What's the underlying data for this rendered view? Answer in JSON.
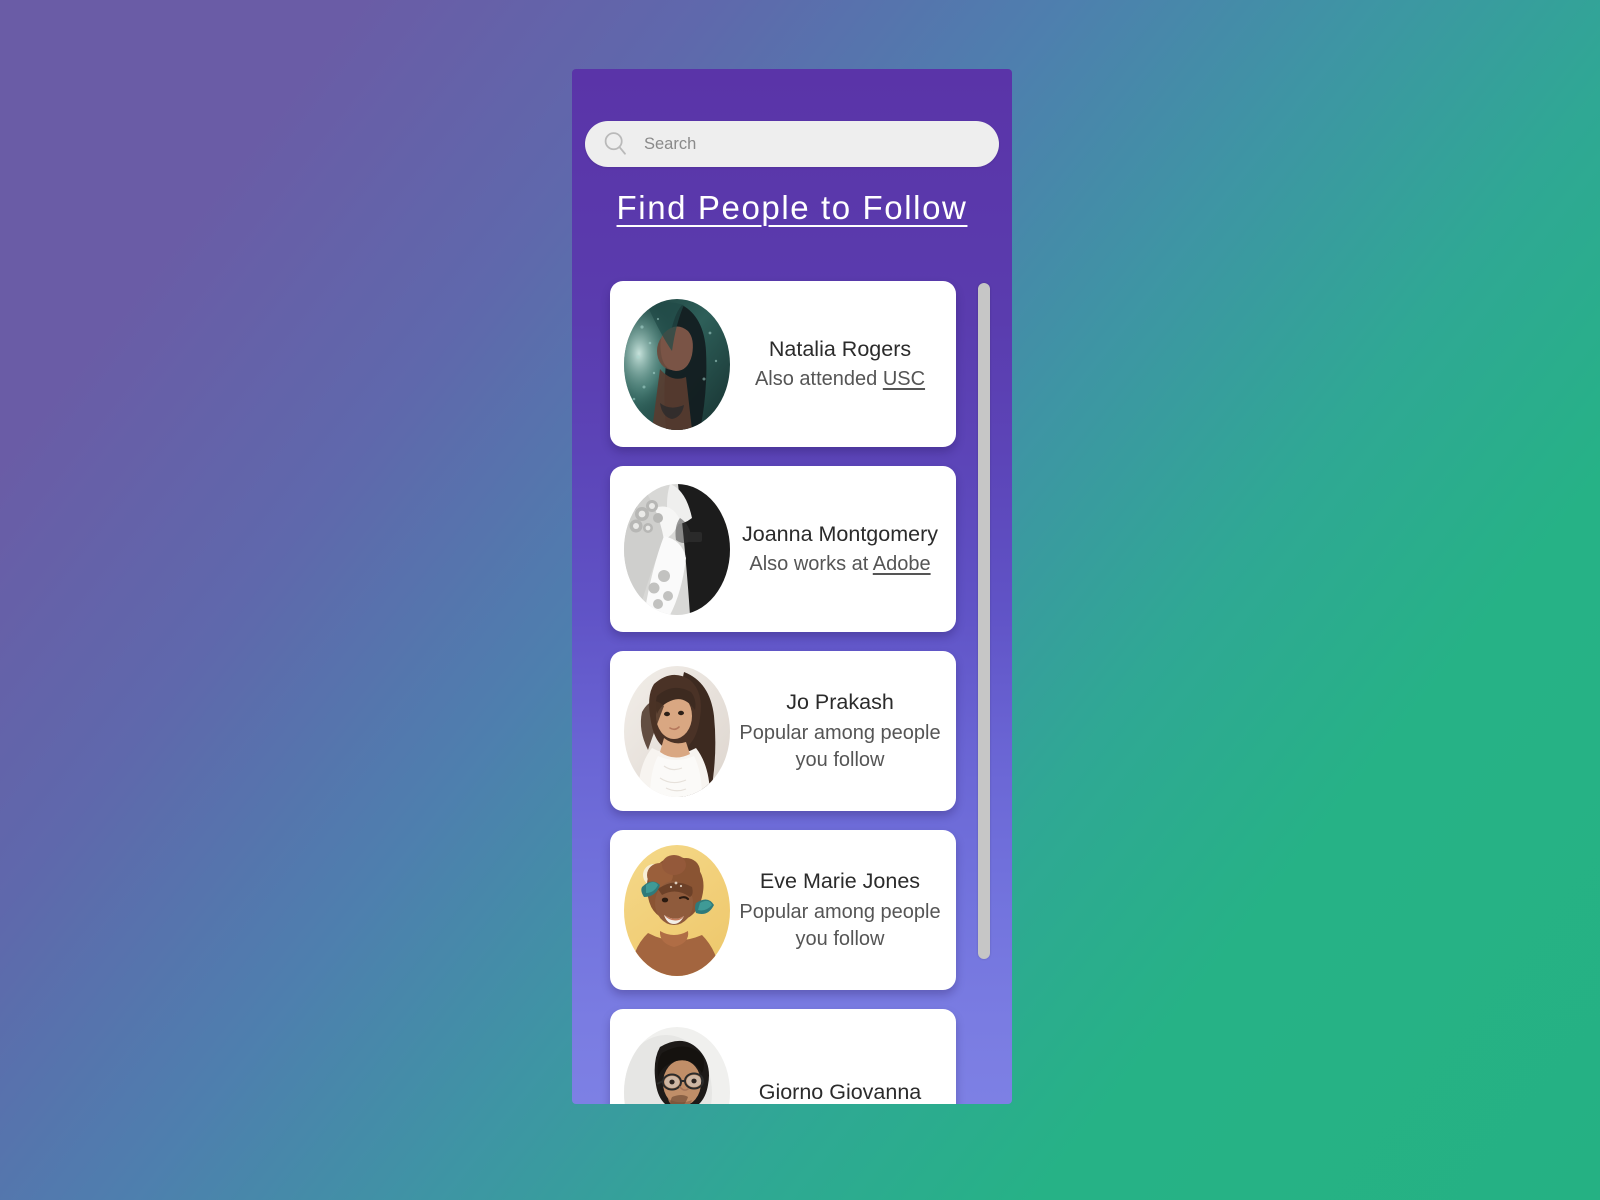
{
  "app": {
    "title": "Find People to Follow"
  },
  "search": {
    "placeholder": "Search",
    "value": "",
    "icon": "search-icon"
  },
  "colors": {
    "page_gradient_start": "#6a5ca6",
    "page_gradient_end": "#25b183",
    "panel_gradient_start": "#5a34a8",
    "panel_gradient_end": "#7d80e4",
    "card_background": "#ffffff",
    "name_text": "#2b2b2b",
    "subtitle_text": "#555555",
    "title_text": "#ffffff",
    "search_background": "#eeeeee",
    "scrollbar_thumb": "#c6c6c6"
  },
  "people": [
    {
      "name": "Natalia Rogers",
      "subtitle_prefix": "Also attended ",
      "subtitle_link": "USC",
      "subtitle_suffix": "",
      "avatar_alt": "natalia-rogers-avatar"
    },
    {
      "name": "Joanna Montgomery",
      "subtitle_prefix": "Also works at ",
      "subtitle_link": "Adobe",
      "subtitle_suffix": "",
      "avatar_alt": "joanna-montgomery-avatar"
    },
    {
      "name": "Jo Prakash",
      "subtitle_prefix": "Popular among people you follow",
      "subtitle_link": "",
      "subtitle_suffix": "",
      "avatar_alt": "jo-prakash-avatar"
    },
    {
      "name": "Eve Marie Jones",
      "subtitle_prefix": "Popular among people you follow",
      "subtitle_link": "",
      "subtitle_suffix": "",
      "avatar_alt": "eve-marie-jones-avatar"
    },
    {
      "name": "Giorno Giovanna",
      "subtitle_prefix": "",
      "subtitle_link": "",
      "subtitle_suffix": "",
      "avatar_alt": "giorno-giovanna-avatar"
    }
  ],
  "scrollbar": {
    "position": "top",
    "thumb_fraction": "0.91"
  }
}
